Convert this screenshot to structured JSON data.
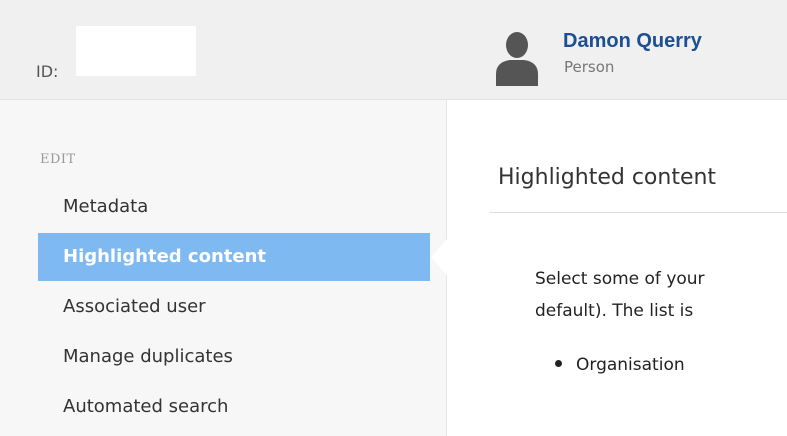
{
  "header": {
    "id_label": "ID:",
    "id_value": "",
    "person": {
      "name": "Damon Querry",
      "type": "Person",
      "avatar_icon": "person-silhouette-icon"
    }
  },
  "sidebar": {
    "section_label": "EDIT",
    "items": [
      {
        "label": "Metadata",
        "active": false
      },
      {
        "label": "Highlighted content",
        "active": true
      },
      {
        "label": "Associated user",
        "active": false
      },
      {
        "label": "Manage duplicates",
        "active": false
      },
      {
        "label": "Automated search",
        "active": false
      }
    ]
  },
  "main": {
    "title": "Highlighted content",
    "description_lines": [
      "Select some of your",
      "default). The list is"
    ],
    "bullets": [
      "Organisation"
    ]
  },
  "colors": {
    "header_bg": "#f0f0f0",
    "sidebar_bg": "#f7f7f7",
    "active_item_bg": "#7eb9f2",
    "link_color": "#1d4f91"
  }
}
